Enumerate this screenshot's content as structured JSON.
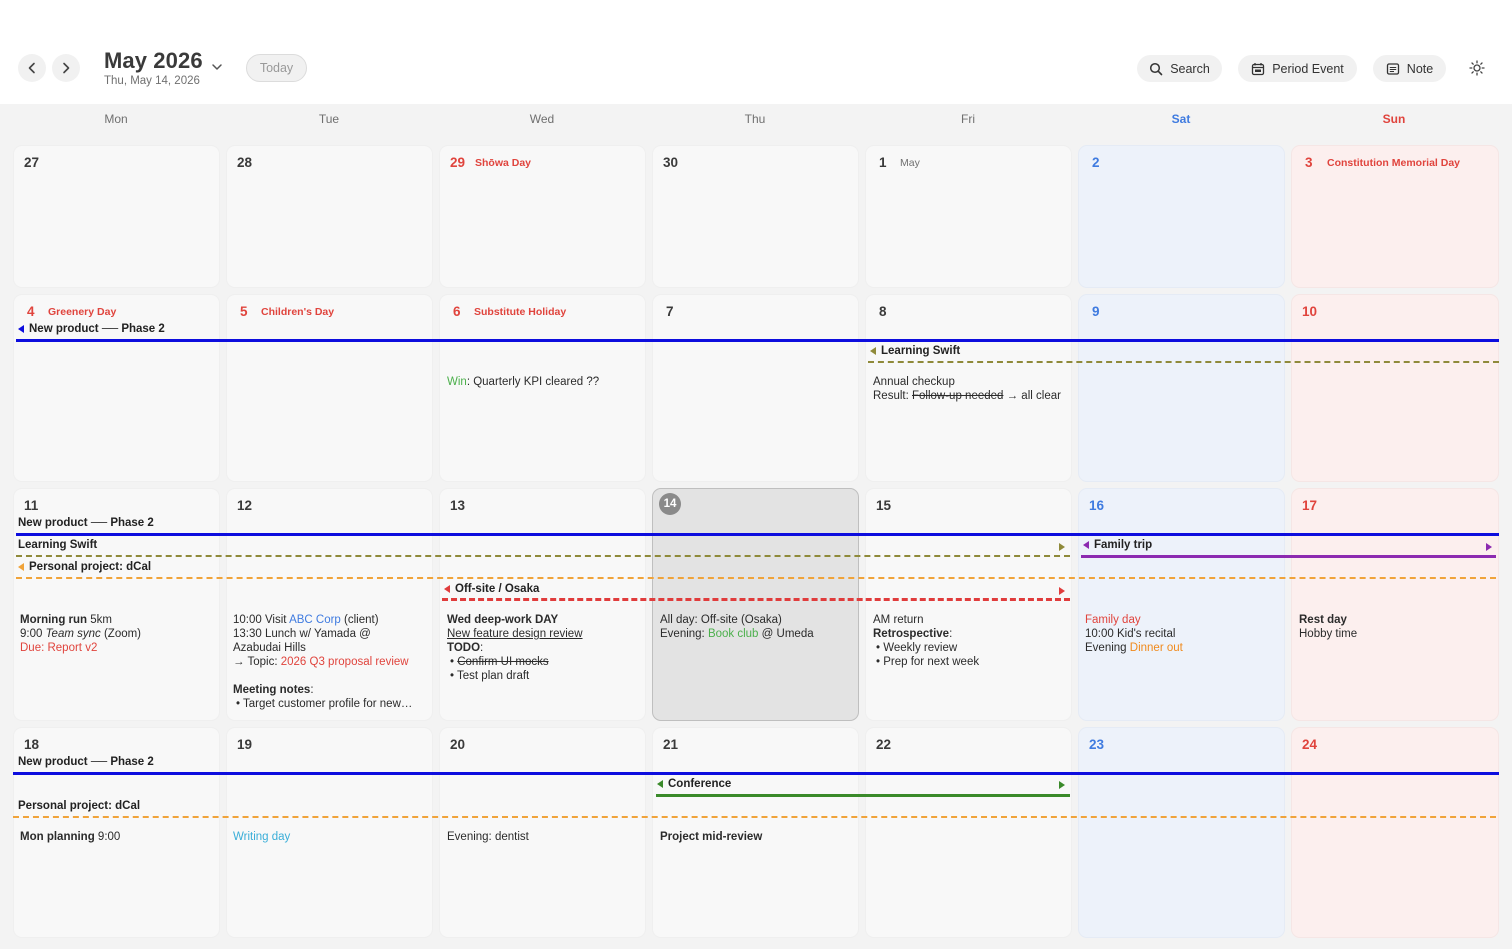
{
  "header": {
    "month_title": "May 2026",
    "selected_date": "Thu, May 14, 2026",
    "today_label": "Today",
    "search_label": "Search",
    "period_event_label": "Period Event",
    "note_label": "Note",
    "icons": [
      "chevron-left-icon",
      "chevron-right-icon",
      "chevron-down-icon",
      "search-icon",
      "calendar-icon",
      "note-icon",
      "sun-icon"
    ]
  },
  "weekdays": [
    "Mon",
    "Tue",
    "Wed",
    "Thu",
    "Fri",
    "Sat",
    "Sun"
  ],
  "colors": {
    "holiday_red": "#e0443d",
    "weekend_blue": "#3f7be0",
    "saturday_bg": "#edf2fa",
    "sunday_bg": "#fcefee",
    "new_product": "#0d0dde",
    "learning_swift": "#8f8a3a",
    "personal_project": "#f0a33a",
    "offsite": "#e03c3c",
    "family_trip": "#8c2ab0",
    "conference": "#3a8a2a"
  },
  "days": {
    "d27": "27",
    "d28": "28",
    "d29": "29",
    "d30": "30",
    "d1": "1",
    "d2": "2",
    "d3": "3",
    "d4": "4",
    "d5": "5",
    "d6": "6",
    "d7": "7",
    "d8": "8",
    "d9": "9",
    "d10": "10",
    "d11": "11",
    "d12": "12",
    "d13": "13",
    "d14": "14",
    "d15": "15",
    "d16": "16",
    "d17": "17",
    "d18": "18",
    "d19": "19",
    "d20": "20",
    "d21": "21",
    "d22": "22",
    "d23": "23",
    "d24": "24"
  },
  "holidays": {
    "showa": "Shōwa Day",
    "may": "May",
    "constitution": "Constitution Memorial Day",
    "greenery": "Greenery Day",
    "children": "Children's Day",
    "substitute": "Substitute Holiday"
  },
  "events": {
    "new_product": "New product ── Phase 2",
    "learning_swift": "Learning Swift",
    "personal_project": "Personal project: dCal",
    "offsite": "Off-site / Osaka",
    "family_trip": "Family trip",
    "conference": "Conference"
  },
  "notes": {
    "wed6_win": "Win",
    "wed6_text": ": Quarterly KPI cleared ??",
    "fri8_line1": "Annual checkup",
    "fri8_result": "Result: ",
    "fri8_struck": "Follow-up needed",
    "fri8_after": " → all clear",
    "mon11_run": "Morning run",
    "mon11_run_dist": " 5km",
    "mon11_sync_time": "9:00 ",
    "mon11_sync": "Team sync",
    "mon11_sync_after": " (Zoom)",
    "mon11_due": "Due: Report v2",
    "tue12_visit": "10:00 Visit ",
    "tue12_abc": "ABC Corp",
    "tue12_client": " (client)",
    "tue12_lunch1": "13:30 Lunch w/ Yamada @",
    "tue12_lunch2": "Azabudai Hills",
    "tue12_topic": "→ Topic: ",
    "tue12_proposal": "2026 Q3 proposal review",
    "tue12_meeting": "Meeting notes",
    "tue12_colon": ":",
    "tue12_bullet": "• Target customer profile for new…",
    "wed13_title": "Wed deep-work DAY",
    "wed13_review": "New feature design review",
    "wed13_todo": "TODO",
    "wed13_todo_colon": ":",
    "wed13_b1": "Confirm UI mocks",
    "wed13_b2": "• Test plan draft",
    "thu14_line1": "All day: Off-site (Osaka)",
    "thu14_evening": "Evening: ",
    "thu14_book": "Book club",
    "thu14_umeda": " @ Umeda",
    "fri15_am": "AM return",
    "fri15_retro": "Retrospective",
    "fri15_colon": ":",
    "fri15_b1": "• Weekly review",
    "fri15_b2": "• Prep for next week",
    "sat16_family": "Family day",
    "sat16_recital": "10:00 Kid's recital",
    "sat16_evening": "Evening ",
    "sat16_dinner": "Dinner out",
    "sun17_rest": "Rest day",
    "sun17_hobby": "Hobby time",
    "mon18_planning": "Mon planning",
    "mon18_time": " 9:00",
    "tue19_writing": "Writing day",
    "wed20_dentist": "Evening: dentist",
    "thu21_review": "Project mid-review"
  }
}
